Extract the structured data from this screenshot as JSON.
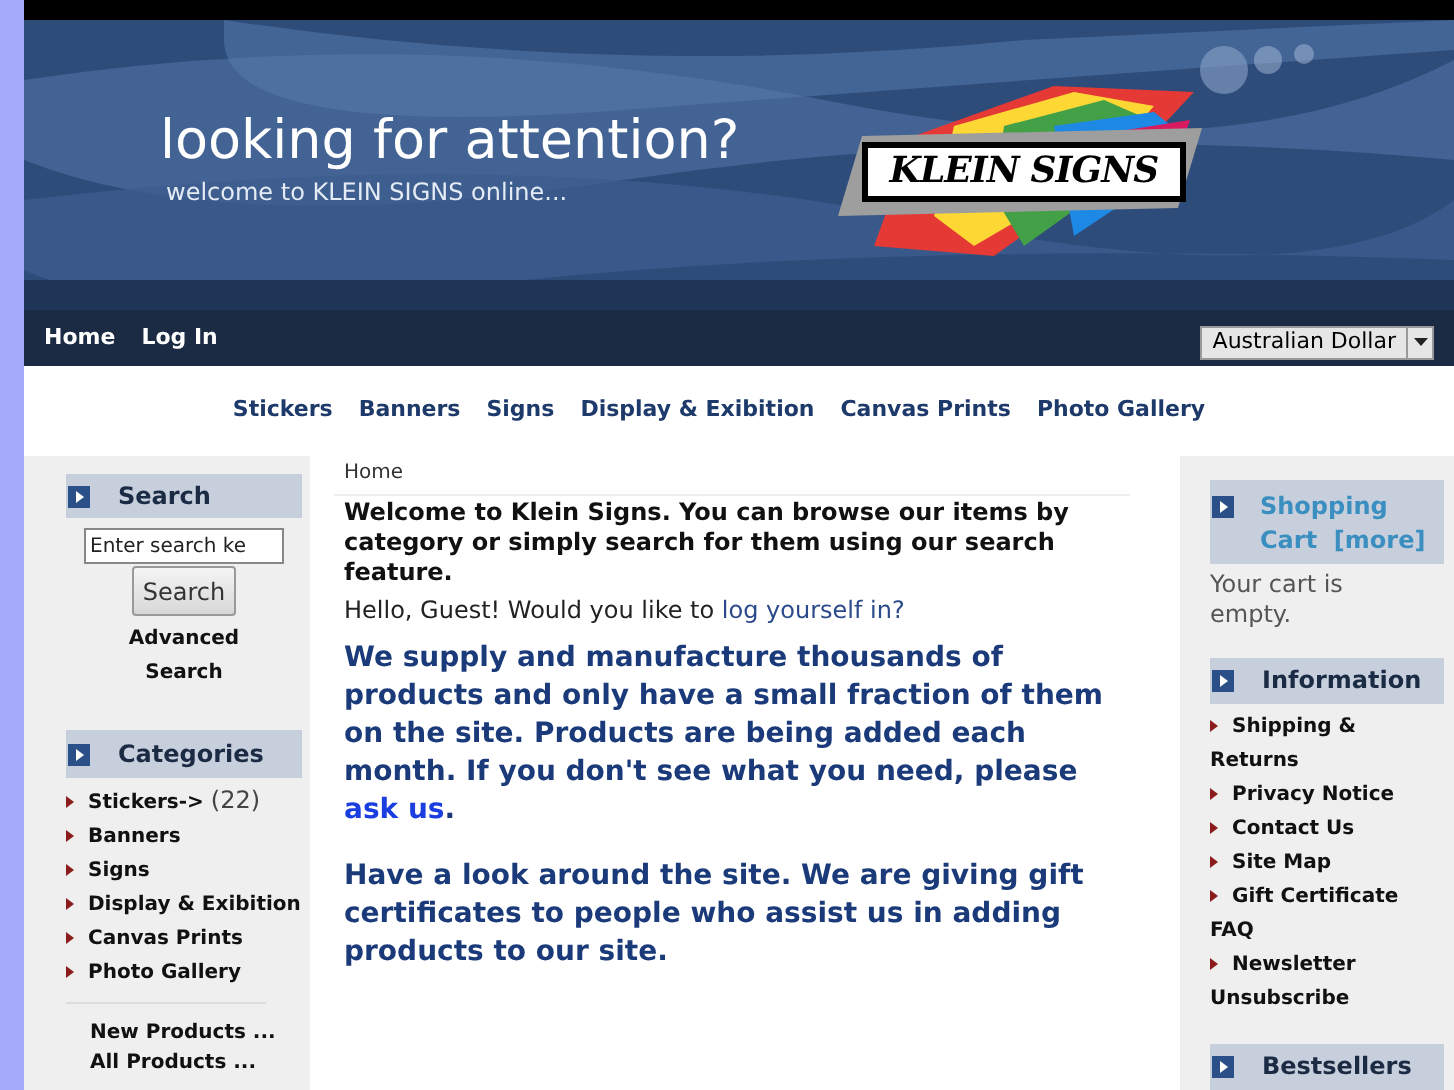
{
  "banner": {
    "headline": "looking for attention?",
    "tagline": "welcome to KLEIN SIGNS online...",
    "logo_text": "KLEIN SIGNS"
  },
  "top_nav": [
    {
      "label": "Home"
    },
    {
      "label": "Log In"
    }
  ],
  "currency": {
    "value": "Australian Dollar"
  },
  "category_nav": [
    "Stickers",
    "Banners",
    "Signs",
    "Display & Exibition",
    "Canvas Prints",
    "Photo Gallery"
  ],
  "left_sidebar": {
    "search": {
      "title": "Search",
      "placeholder": "Enter search ke",
      "button": "Search",
      "advanced_link": "Advanced Search"
    },
    "categories": {
      "title": "Categories",
      "items": [
        {
          "label": "Stickers->",
          "count": "(22)"
        },
        {
          "label": "Banners"
        },
        {
          "label": "Signs"
        },
        {
          "label": "Display & Exibition"
        },
        {
          "label": "Canvas Prints"
        },
        {
          "label": "Photo Gallery"
        }
      ],
      "extra_links": [
        "New Products ...",
        "All Products ..."
      ]
    }
  },
  "main": {
    "breadcrumb": "Home",
    "welcome": "Welcome to Klein Signs. You can browse our items by category or simply search for them using our search feature.",
    "greeting": "Hello, Guest! Would you like to ",
    "greeting_link": "log yourself in?",
    "paragraph_1": "We supply and manufacture thousands of products and only have a small fraction of them on the site.  Products are being added each month.  If you don't see what you need, please ",
    "paragraph_1_link": "ask us",
    "paragraph_1_end": ".",
    "paragraph_2": "Have a look around the site.  We are giving gift certificates to people who assist us in adding products to our site."
  },
  "right_sidebar": {
    "cart": {
      "title": "Shopping Cart",
      "more_link": "[more]",
      "message": "Your cart is empty."
    },
    "information": {
      "title": "Information",
      "items": [
        "Shipping & Returns",
        "Privacy Notice",
        "Contact Us",
        "Site Map",
        "Gift Certificate FAQ",
        "Newsletter Unsubscribe"
      ]
    },
    "bestsellers": {
      "title": "Bestsellers"
    }
  }
}
